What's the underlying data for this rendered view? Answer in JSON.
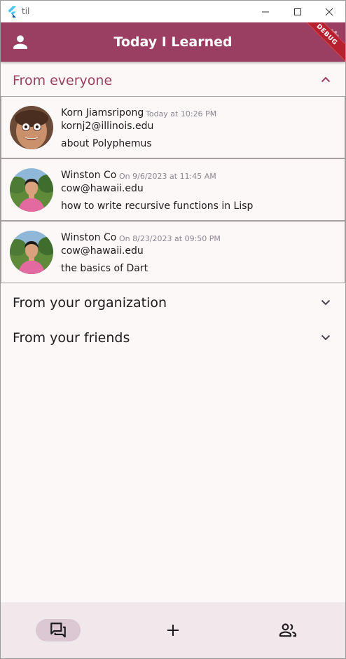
{
  "window": {
    "title": "til"
  },
  "appbar": {
    "title": "Today I Learned",
    "debug_label": "DEBUG"
  },
  "colors": {
    "primary": "#9b3f62",
    "section_active": "#9b3f62",
    "text": "#1d1b1e",
    "muted": "#8b8590",
    "nav_background": "#f1e8ec",
    "nav_indicator": "#dcc8d2"
  },
  "sections": {
    "everyone": {
      "title": "From everyone",
      "expanded": true,
      "entries": [
        {
          "name": "Korn Jiamsripong",
          "time": "Today at 10:26 PM",
          "email": "kornj2@illinois.edu",
          "topic": "about Polyphemus"
        },
        {
          "name": "Winston Co",
          "time": "On 9/6/2023 at 11:45 AM",
          "email": "cow@hawaii.edu",
          "topic": "how to write recursive functions in Lisp"
        },
        {
          "name": "Winston Co",
          "time": "On 8/23/2023 at 09:50 PM",
          "email": "cow@hawaii.edu",
          "topic": "the basics of Dart"
        }
      ]
    },
    "organization": {
      "title": "From your organization",
      "expanded": false
    },
    "friends": {
      "title": "From your friends",
      "expanded": false
    }
  },
  "bottom_nav": {
    "items": [
      {
        "icon": "forum-icon",
        "active": true
      },
      {
        "icon": "add-icon",
        "active": false
      },
      {
        "icon": "people-icon",
        "active": false
      }
    ]
  }
}
